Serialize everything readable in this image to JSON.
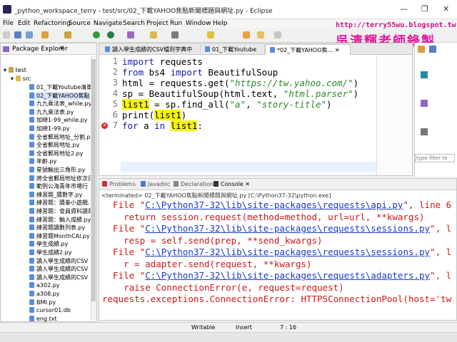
{
  "window": {
    "title": "_python_workspace_terry - test/src/02_下載YAHOO焦點新聞標題與網址.py - Eclipse"
  },
  "menu": [
    "File",
    "Edit",
    "Refactoring",
    "Source",
    "Navigate",
    "Search",
    "Project",
    "Run",
    "Window",
    "Help"
  ],
  "watermark": {
    "url": "http://terry55wu.blogspot.tw",
    "name": "吳清輝老師錄製"
  },
  "package_explorer": {
    "title": "Package Explorer",
    "project": "test",
    "folder": "src",
    "files": [
      "01_下載Youtube清單",
      "02_下載YAHOO焦點",
      "九九乘法表_while.py",
      "九九乘法表.py",
      "加總1-99_while.py",
      "加總1-99.py",
      "全省郵局地址_分割.p",
      "全省郵局地址.py",
      "全省郵局地址2.py",
      "年齡.py",
      "星號輸出三角形.py",
      "將全省郵局地址依次日",
      "範例公海青年市場行",
      "練習題_猜數字.py",
      "練習題：猜拳小遊戲.",
      "練習題：會員資料讀目",
      "練習題：輸入成績.py",
      "練習題讀數列表.py",
      "練習題MonthCAl.py",
      "學生成績.py",
      "學生成績2.py",
      "讀入學生成績的CSV",
      "讀入學生成績的CSV",
      "讀入學生成績的CSV",
      "a302.py",
      "a308.py",
      "BMI.py",
      "cursor01.db",
      "eng.txt"
    ]
  },
  "editor": {
    "tabs": [
      "讀入學生成績的CSV檔到字典中",
      "01_下載Youtube",
      "*02_下載YAHOO焦..."
    ],
    "lines": [
      {
        "n": "1",
        "parts": [
          {
            "k": "kw",
            "t": "import"
          },
          {
            "k": "",
            "t": " requests"
          }
        ]
      },
      {
        "n": "2",
        "parts": [
          {
            "k": "kw",
            "t": "from"
          },
          {
            "k": "",
            "t": " bs4 "
          },
          {
            "k": "kw",
            "t": "import"
          },
          {
            "k": "",
            "t": " BeautifulSoup"
          }
        ]
      },
      {
        "n": "3",
        "parts": [
          {
            "k": "",
            "t": "html = requests.get("
          },
          {
            "k": "st",
            "t": "\"https://tw.yahoo.com/\""
          },
          {
            "k": "",
            "t": ")"
          }
        ]
      },
      {
        "n": "4",
        "parts": [
          {
            "k": "",
            "t": "sp = BeautifulSoup(html.text, "
          },
          {
            "k": "st",
            "t": "\"html.parser\""
          },
          {
            "k": "",
            "t": ")"
          }
        ]
      },
      {
        "n": "5",
        "parts": [
          {
            "k": "hl",
            "t": "list1"
          },
          {
            "k": "",
            "t": " = sp.find_all("
          },
          {
            "k": "st",
            "t": "\"a\""
          },
          {
            "k": "",
            "t": ", "
          },
          {
            "k": "st",
            "t": "\"story-title\""
          },
          {
            "k": "",
            "t": ")"
          }
        ]
      },
      {
        "n": "6",
        "parts": [
          {
            "k": "",
            "t": "print("
          },
          {
            "k": "hl",
            "t": "list1"
          },
          {
            "k": "",
            "t": ")"
          }
        ]
      },
      {
        "n": "7",
        "parts": [
          {
            "k": "kw",
            "t": "for"
          },
          {
            "k": "",
            "t": " a "
          },
          {
            "k": "kw",
            "t": "in"
          },
          {
            "k": "",
            "t": " "
          },
          {
            "k": "hl",
            "t": "list1"
          },
          {
            "k": "",
            "t": ":"
          }
        ]
      }
    ]
  },
  "outline": {
    "filter_placeholder": "type filter te"
  },
  "console": {
    "tabs": [
      "Problems",
      "Javadoc",
      "Declaration",
      "Console"
    ],
    "terminated": "<terminated> 02_下載YAHOO焦點新聞標題與網址.py [C:\\Python37-32\\python.exe]",
    "lines": [
      {
        "pre": "  File \"",
        "link": "C:\\Python37-32\\lib\\site-packages\\requests\\api.py",
        "post": "\", line 6"
      },
      {
        "pre": "    return session.request(method=method, url=url, **kwargs)",
        "link": "",
        "post": ""
      },
      {
        "pre": "  File \"",
        "link": "C:\\Python37-32\\lib\\site-packages\\requests\\sessions.py",
        "post": "\", l"
      },
      {
        "pre": "    resp = self.send(prep, **send_kwargs)",
        "link": "",
        "post": ""
      },
      {
        "pre": "  File \"",
        "link": "C:\\Python37-32\\lib\\site-packages\\requests\\sessions.py",
        "post": "\", l"
      },
      {
        "pre": "    r = adapter.send(request, **kwargs)",
        "link": "",
        "post": ""
      },
      {
        "pre": "  File \"",
        "link": "C:\\Python37-32\\lib\\site-packages\\requests\\adapters.py",
        "post": "\", l"
      },
      {
        "pre": "    raise ConnectionError(e, request=request)",
        "link": "",
        "post": ""
      },
      {
        "pre": "requests.exceptions.ConnectionError: HTTPSConnectionPool(host='tw",
        "link": "",
        "post": ""
      }
    ]
  },
  "status": {
    "mode": "Writable",
    "insert": "Insert",
    "position": "7 : 16"
  }
}
